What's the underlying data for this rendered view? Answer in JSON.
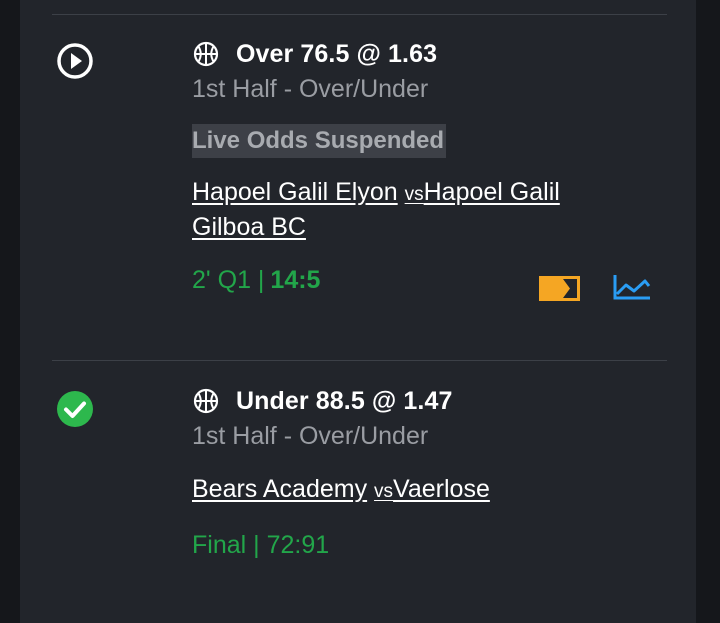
{
  "bets": [
    {
      "status": "live",
      "selection": "Over 76.5 @ 1.63",
      "market": "1st Half - Over/Under",
      "suspended_label": "Live Odds Suspended",
      "home_team": "Hapoel Galil Elyon",
      "vs": "vs",
      "away_team": "Hapoel Galil Gilboa BC",
      "time": "2' Q1 |",
      "score": "14:5"
    },
    {
      "status": "won",
      "selection": "Under 88.5 @ 1.47",
      "market": "1st Half - Over/Under",
      "home_team": "Bears Academy",
      "vs": "vs",
      "away_team": "Vaerlose",
      "result": "Final | 72:91"
    }
  ],
  "colors": {
    "live_green": "#22a64a",
    "won_badge": "#2db84d",
    "stream_icon": "#f5a623",
    "stats_icon": "#2a9df4"
  },
  "icons": [
    "play-circle-icon",
    "basketball-icon",
    "live-stream-icon",
    "stats-chart-icon",
    "check-circle-icon"
  ]
}
